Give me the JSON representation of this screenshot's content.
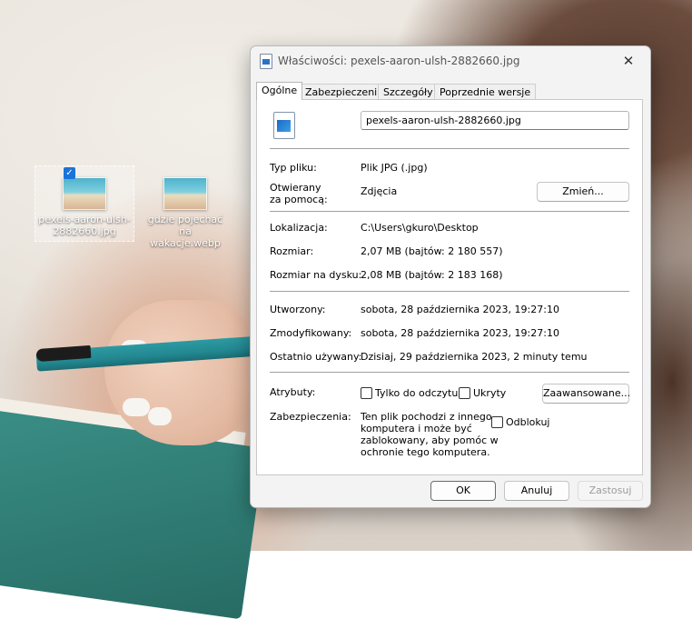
{
  "desktop": {
    "icons": [
      {
        "label": "pexels-aaron-ulsh-2882660.jpg",
        "selected": true
      },
      {
        "label": "gdzie pojechać na wakacje.webp",
        "selected": false
      }
    ]
  },
  "dialog": {
    "title": "Właściwości: pexels-aaron-ulsh-2882660.jpg",
    "close_glyph": "✕",
    "tabs": [
      "Ogólne",
      "Zabezpieczenia",
      "Szczegóły",
      "Poprzednie wersje"
    ],
    "active_tab": "Ogólne",
    "general": {
      "filename": "pexels-aaron-ulsh-2882660.jpg",
      "file_type_label": "Typ pliku:",
      "file_type_value": "Plik JPG (.jpg)",
      "opens_with_label_1": "Otwierany",
      "opens_with_label_2": "za pomocą:",
      "opens_with_value": "Zdjęcia",
      "change_button": "Zmień...",
      "location_label": "Lokalizacja:",
      "location_value": "C:\\Users\\gkuro\\Desktop",
      "size_label": "Rozmiar:",
      "size_value": "2,07 MB (bajtów: 2 180 557)",
      "size_on_disk_label": "Rozmiar na dysku:",
      "size_on_disk_value": "2,08 MB (bajtów: 2 183 168)",
      "created_label": "Utworzony:",
      "created_value": "sobota, 28 października 2023, 19:27:10",
      "modified_label": "Zmodyfikowany:",
      "modified_value": "sobota, 28 października 2023, 19:27:10",
      "accessed_label": "Ostatnio używany:",
      "accessed_value": "Dzisiaj, 29 października 2023, 2 minuty temu",
      "attributes_label": "Atrybuty:",
      "readonly_label": "Tylko do odczytu",
      "readonly_checked": false,
      "hidden_label": "Ukryty",
      "hidden_checked": false,
      "advanced_button": "Zaawansowane...",
      "security_label": "Zabezpieczenia:",
      "security_text_1": "Ten plik pochodzi z innego",
      "security_text_2": "komputera i może być",
      "security_text_3": "zablokowany, aby pomóc w",
      "security_text_4": "ochronie tego komputera.",
      "unblock_label": "Odblokuj",
      "unblock_checked": false
    },
    "buttons": {
      "ok": "OK",
      "cancel": "Anuluj",
      "apply": "Zastosuj"
    }
  },
  "colors": {
    "accent": "#1a73d9",
    "dialog_bg": "#f3f3f3",
    "panel_bg": "#ffffff"
  }
}
